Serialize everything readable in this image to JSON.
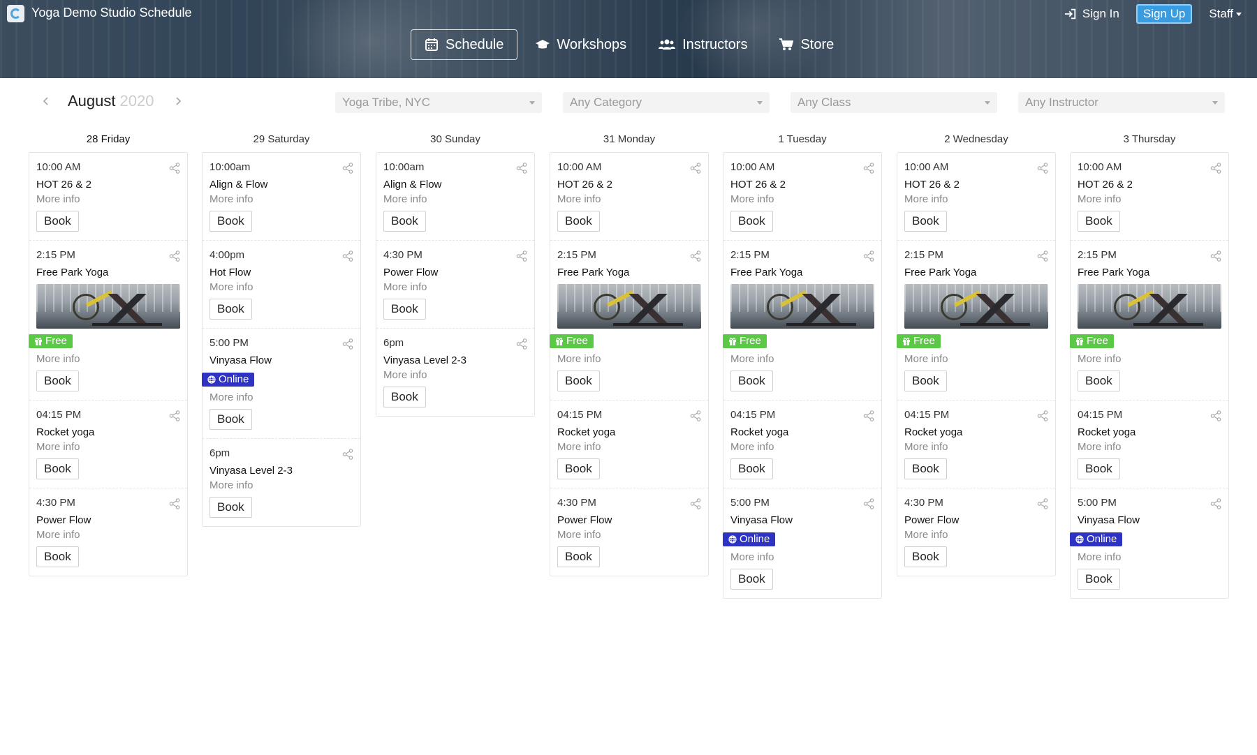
{
  "app": {
    "title": "Yoga Demo Studio Schedule"
  },
  "nav": {
    "items": [
      {
        "label": "Schedule",
        "icon": "calendar-icon",
        "active": true
      },
      {
        "label": "Workshops",
        "icon": "graduation-cap-icon",
        "active": false
      },
      {
        "label": "Instructors",
        "icon": "users-icon",
        "active": false
      },
      {
        "label": "Store",
        "icon": "cart-icon",
        "active": false
      }
    ]
  },
  "account": {
    "sign_in": "Sign In",
    "sign_up": "Sign Up",
    "staff": "Staff"
  },
  "calendar": {
    "month": "August",
    "year": "2020"
  },
  "filters": {
    "location": "Yoga Tribe, NYC",
    "category": "Any Category",
    "class": "Any Class",
    "instructor": "Any Instructor"
  },
  "labels": {
    "more_info": "More info",
    "book": "Book",
    "free": "Free",
    "online": "Online"
  },
  "colors": {
    "free_badge": "#5cc946",
    "online_badge": "#2f33c4",
    "signup": "#3a9ce0"
  },
  "days": [
    {
      "header": "28 Friday",
      "classes": [
        {
          "time": "10:00 AM",
          "name": "HOT 26 & 2"
        },
        {
          "time": "2:15 PM",
          "name": "Free Park Yoga",
          "image": true,
          "badge": "free"
        },
        {
          "time": "04:15 PM",
          "name": "Rocket yoga"
        },
        {
          "time": "4:30 PM",
          "name": "Power Flow"
        }
      ]
    },
    {
      "header": "29 Saturday",
      "classes": [
        {
          "time": "10:00am",
          "name": "Align & Flow"
        },
        {
          "time": "4:00pm",
          "name": "Hot Flow"
        },
        {
          "time": "5:00 PM",
          "name": "Vinyasa Flow",
          "badge": "online"
        },
        {
          "time": "6pm",
          "name": "Vinyasa Level 2-3"
        }
      ]
    },
    {
      "header": "30 Sunday",
      "classes": [
        {
          "time": "10:00am",
          "name": "Align & Flow"
        },
        {
          "time": "4:30 PM",
          "name": "Power Flow"
        },
        {
          "time": "6pm",
          "name": "Vinyasa Level 2-3"
        }
      ]
    },
    {
      "header": "31 Monday",
      "classes": [
        {
          "time": "10:00 AM",
          "name": "HOT 26 & 2"
        },
        {
          "time": "2:15 PM",
          "name": "Free Park Yoga",
          "image": true,
          "badge": "free"
        },
        {
          "time": "04:15 PM",
          "name": "Rocket yoga"
        },
        {
          "time": "4:30 PM",
          "name": "Power Flow"
        }
      ]
    },
    {
      "header": "1 Tuesday",
      "classes": [
        {
          "time": "10:00 AM",
          "name": "HOT 26 & 2"
        },
        {
          "time": "2:15 PM",
          "name": "Free Park Yoga",
          "image": true,
          "badge": "free"
        },
        {
          "time": "04:15 PM",
          "name": "Rocket yoga"
        },
        {
          "time": "5:00 PM",
          "name": "Vinyasa Flow",
          "badge": "online"
        }
      ]
    },
    {
      "header": "2 Wednesday",
      "classes": [
        {
          "time": "10:00 AM",
          "name": "HOT 26 & 2"
        },
        {
          "time": "2:15 PM",
          "name": "Free Park Yoga",
          "image": true,
          "badge": "free"
        },
        {
          "time": "04:15 PM",
          "name": "Rocket yoga"
        },
        {
          "time": "4:30 PM",
          "name": "Power Flow"
        }
      ]
    },
    {
      "header": "3 Thursday",
      "classes": [
        {
          "time": "10:00 AM",
          "name": "HOT 26 & 2"
        },
        {
          "time": "2:15 PM",
          "name": "Free Park Yoga",
          "image": true,
          "badge": "free"
        },
        {
          "time": "04:15 PM",
          "name": "Rocket yoga"
        },
        {
          "time": "5:00 PM",
          "name": "Vinyasa Flow",
          "badge": "online"
        }
      ]
    }
  ]
}
